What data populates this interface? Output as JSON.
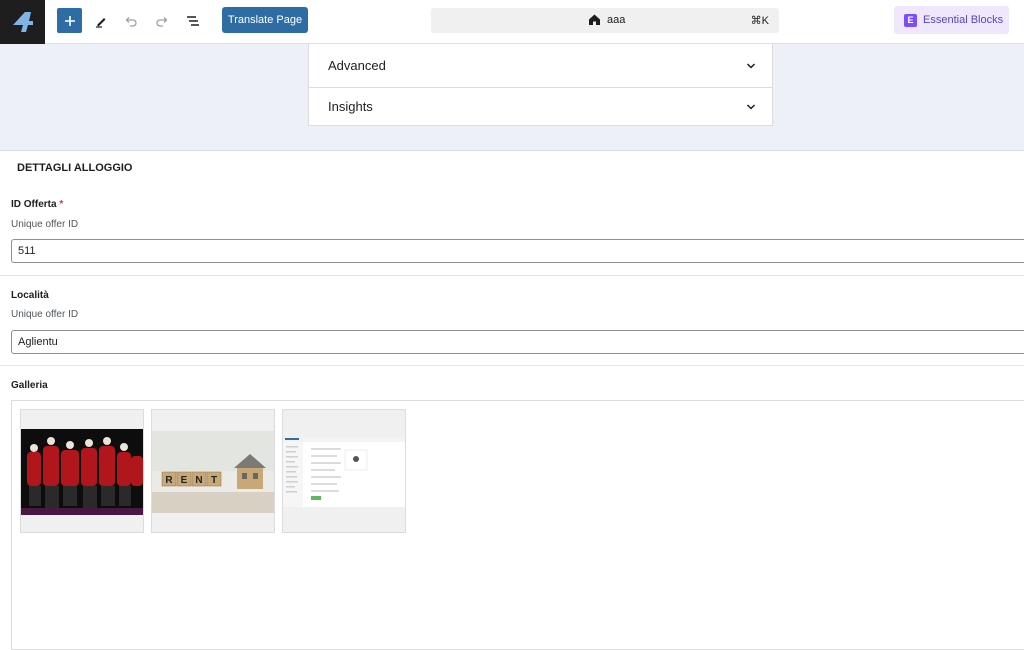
{
  "toolbar": {
    "translate_label": "Translate Page",
    "command_title": "aaa",
    "command_shortcut": "⌘K",
    "essential_blocks_label": "Essential Blocks"
  },
  "panels": [
    {
      "label": "Advanced"
    },
    {
      "label": "Insights"
    }
  ],
  "meta": {
    "title": "DETTAGLI ALLOGGIO",
    "fields": [
      {
        "label": "ID Offerta",
        "required_mark": "*",
        "description": "Unique offer ID",
        "value": "511"
      },
      {
        "label": "Località",
        "description": "Unique offer ID",
        "value": "Aglientu"
      }
    ],
    "gallery_label": "Galleria",
    "gallery_items": [
      {
        "icon": "folk-dancers-photo"
      },
      {
        "icon": "rent-blocks-house-photo",
        "text": "RENT"
      },
      {
        "icon": "admin-screenshot-photo"
      }
    ]
  },
  "colors": {
    "primary": "#2e6da4",
    "panel_bg": "#edf1f7",
    "brand_purple": "#7c4dff"
  }
}
